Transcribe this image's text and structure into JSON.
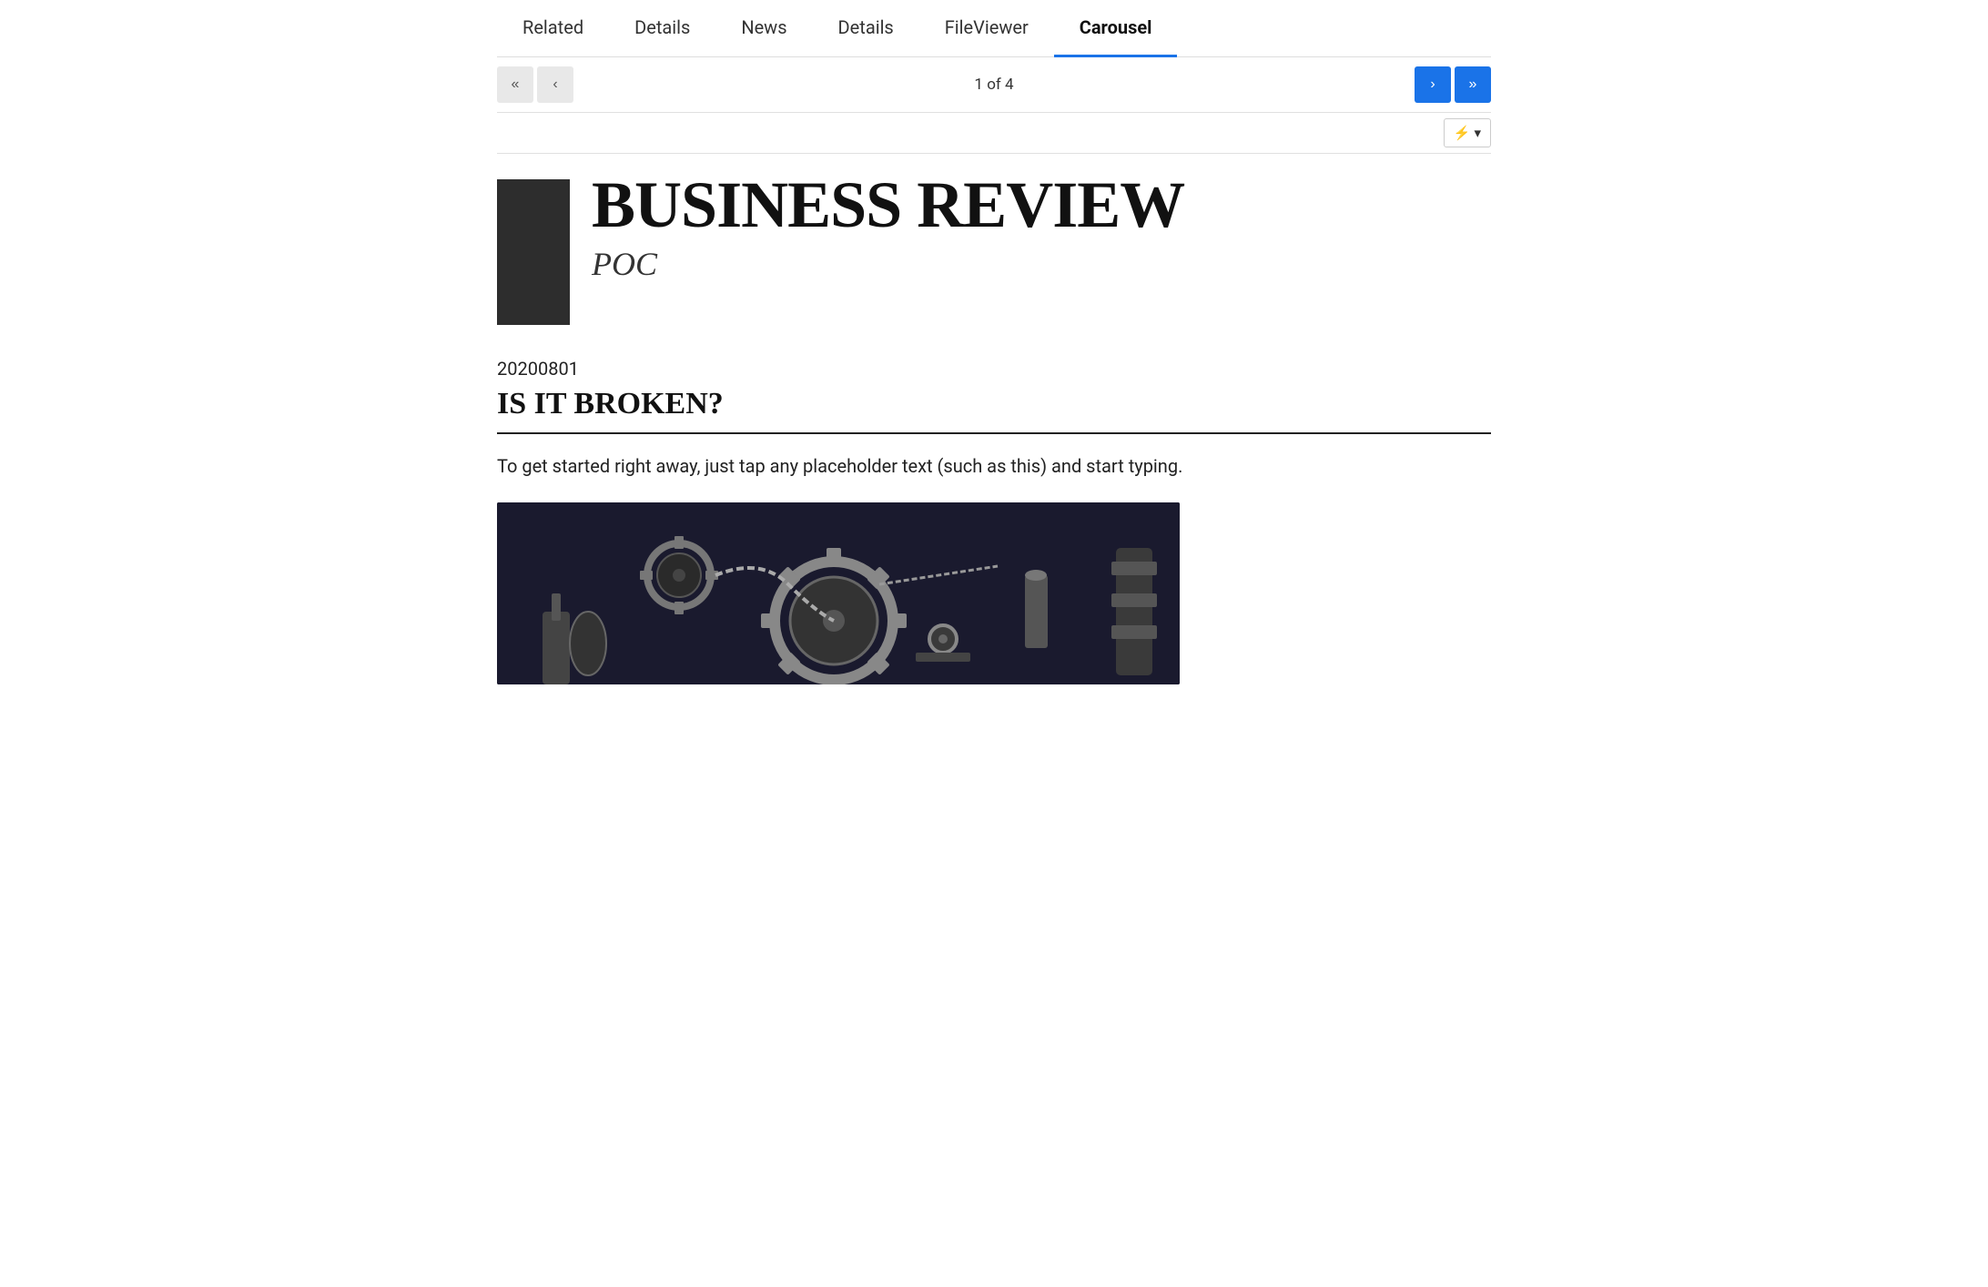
{
  "tabs": [
    {
      "id": "related",
      "label": "Related",
      "active": false
    },
    {
      "id": "details1",
      "label": "Details",
      "active": false
    },
    {
      "id": "news",
      "label": "News",
      "active": false
    },
    {
      "id": "details2",
      "label": "Details",
      "active": false
    },
    {
      "id": "fileviewer",
      "label": "FileViewer",
      "active": false
    },
    {
      "id": "carousel",
      "label": "Carousel",
      "active": true
    }
  ],
  "nav": {
    "first_label": "«",
    "prev_label": "‹",
    "next_label": "›",
    "last_label": "»",
    "page_info": "1 of 4"
  },
  "action_btn": {
    "icon": "⚡",
    "dropdown": "▾"
  },
  "publication": {
    "title": "BUSINESS REVIEW",
    "subtitle": "POC"
  },
  "article": {
    "date": "20200801",
    "headline": "IS IT BROKEN?",
    "body": "To get started right away, just tap any placeholder text (such as this) and start typing."
  },
  "colors": {
    "active_tab_underline": "#1a73e8",
    "nav_btn_blue": "#1a73e8",
    "nav_btn_grey": "#e8e8e8",
    "pub_logo_bg": "#2d2d2d"
  }
}
